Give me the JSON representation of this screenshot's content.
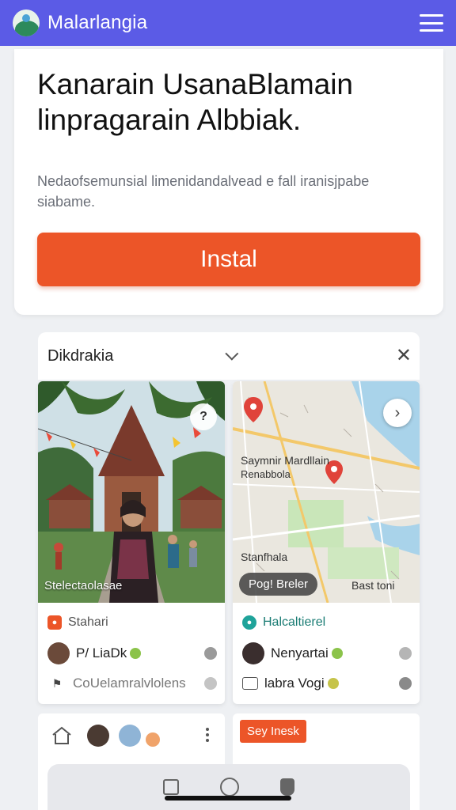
{
  "app": {
    "title": "Malarlangia",
    "accent": "#5b5be6",
    "cta_color": "#ec5528"
  },
  "hero": {
    "title_line1": "Kanarain UsanaBlamain",
    "title_line2": "linpragarain Albbiak.",
    "description_line1": "Nedaofsemunsial limenidandalvead e fall iranisjpabe",
    "description_line2": "siabame.",
    "install_label": "Instal"
  },
  "panel": {
    "title": "Dikdrakia",
    "expand_icon": "chevron-down-icon",
    "close_icon": "close-icon",
    "close_glyph": "✕"
  },
  "cards": [
    {
      "photo_caption": "Stelectaolasae",
      "action_glyph": "?",
      "category": "Stahari",
      "category_color": "#ec5528",
      "user_name": "P/ LiaDk",
      "meta_text": "CoUelamralvlolens"
    },
    {
      "map_label_line1": "Saymnir Mardllain",
      "map_label_line2": "Renabbola",
      "map_label_lower": "Stanfhala",
      "map_chip": "Pog! Breler",
      "map_corner": "Bast toni",
      "next_glyph": "›",
      "category": "Halcaltierel",
      "category_color": "#1fa39a",
      "user_name": "Nenyartai",
      "meta_text": "labra Vogi"
    }
  ],
  "lower": {
    "tag_label": "Sey Inesk"
  }
}
